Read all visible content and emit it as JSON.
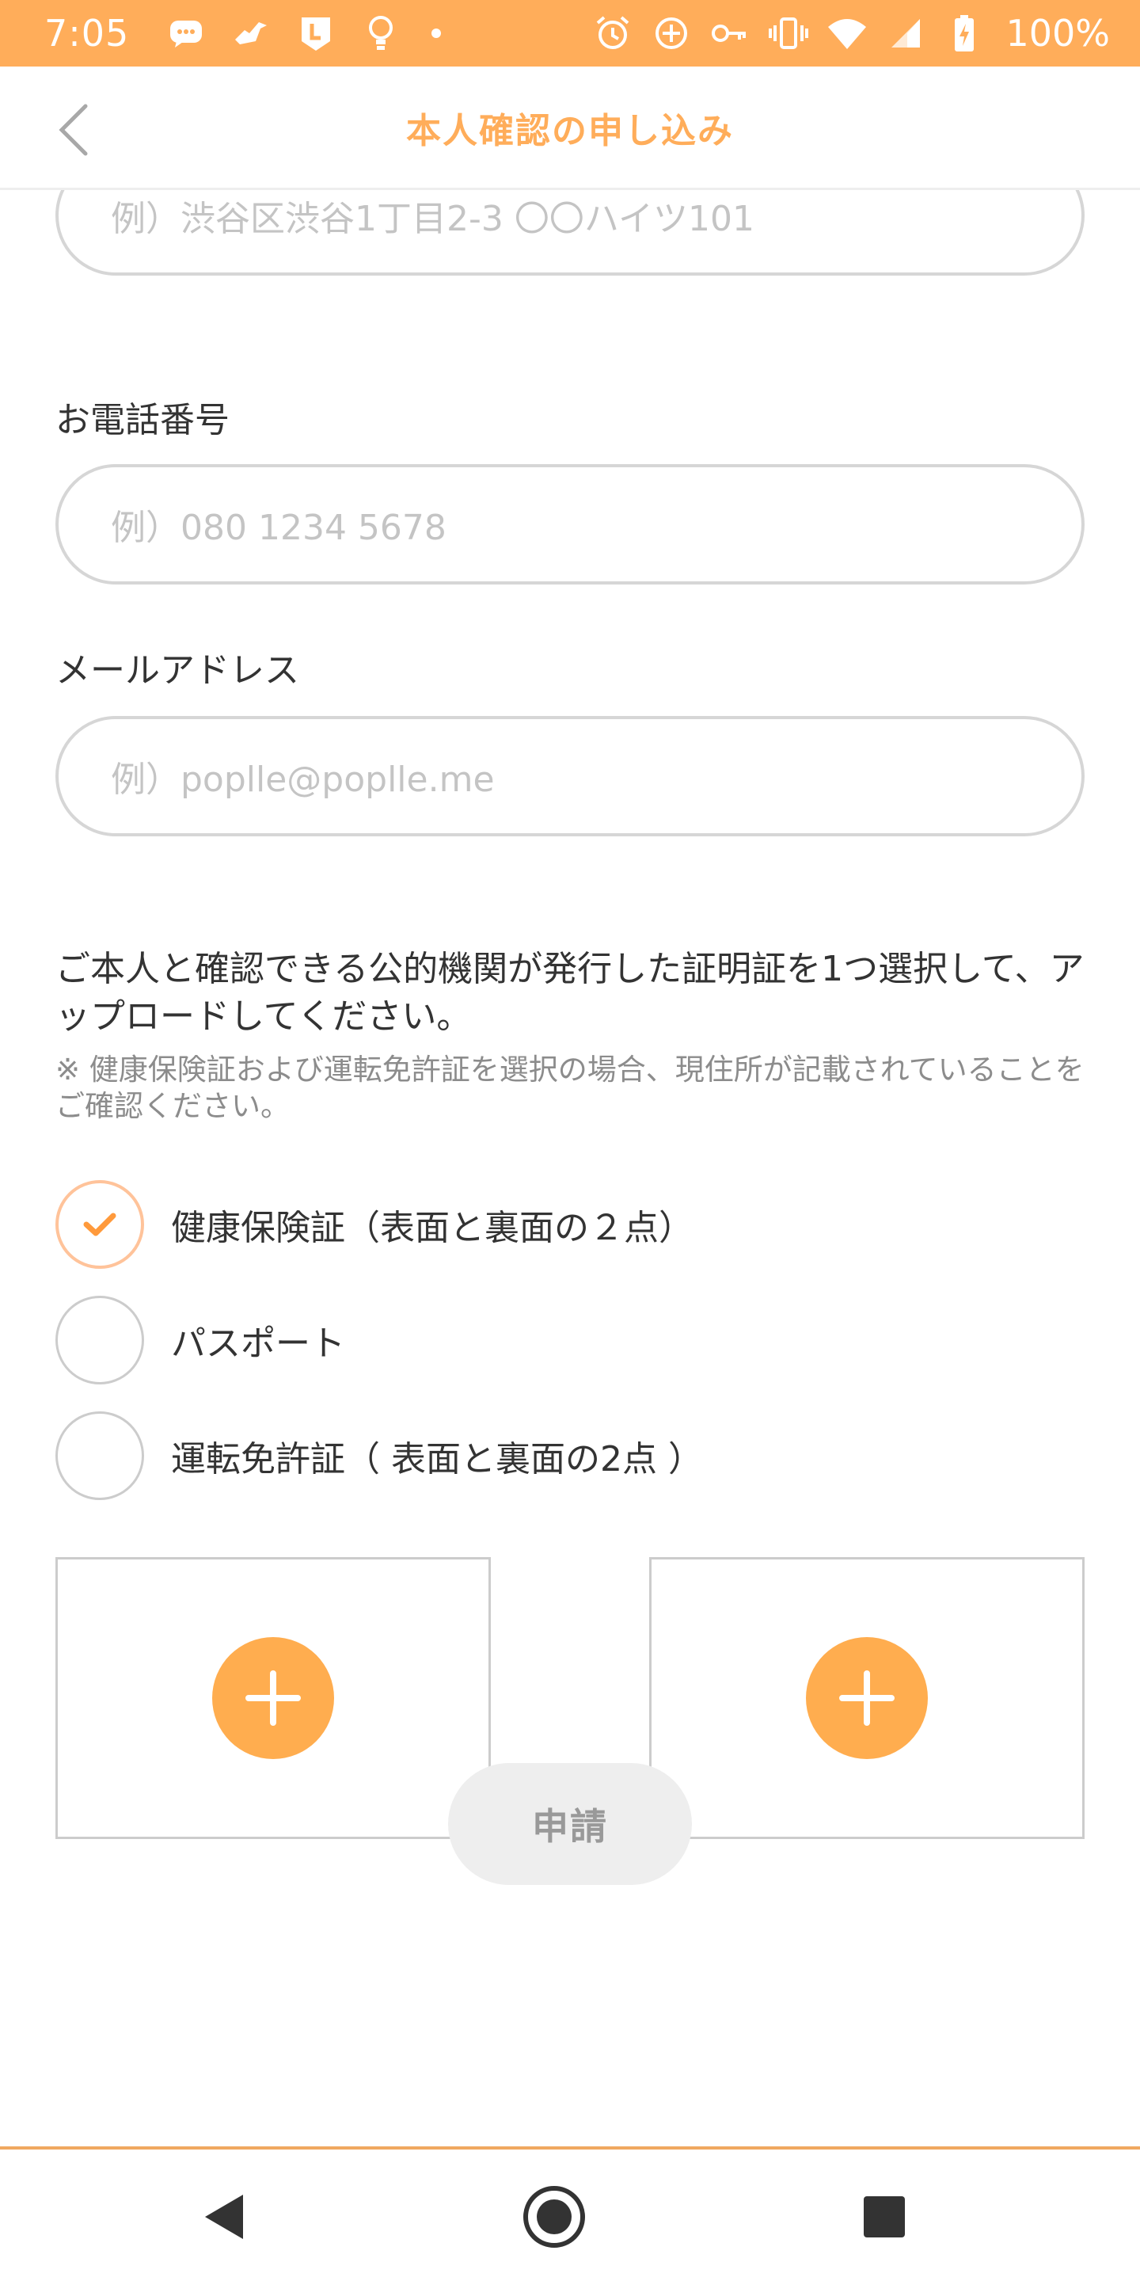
{
  "status_bar": {
    "time": "7:05",
    "battery": "100%",
    "background_color": "#ffad5a",
    "left_icons": [
      "chat-bubble-icon",
      "bird-icon",
      "line-app-icon",
      "lightbulb-icon",
      "notification-dot-icon"
    ],
    "right_icons": [
      "alarm-icon",
      "sync-icon",
      "key-icon",
      "vibrate-icon",
      "wifi-icon",
      "signal-icon",
      "battery-charging-icon"
    ]
  },
  "header": {
    "title": "本人確認の申し込み",
    "accent_color": "#ffad5a"
  },
  "form": {
    "address": {
      "placeholder": "例）渋谷区渋谷1丁目2-3 〇〇ハイツ101"
    },
    "phone": {
      "label": "お電話番号",
      "placeholder": "例）080 1234 5678"
    },
    "email": {
      "label": "メールアドレス",
      "placeholder": "例）poplle@poplle.me"
    },
    "id_instruction": "ご本人と確認できる公的機関が発行した証明証を1つ選択して、アップロードしてください。",
    "id_note": "※ 健康保険証および運転免許証を選択の場合、現住所が記載されていることをご確認ください。",
    "id_options": [
      {
        "label": "健康保険証（表面と裏面の２点）",
        "checked": true
      },
      {
        "label": "パスポート",
        "checked": false
      },
      {
        "label": "運転免許証（ 表面と裏面の2点 ）",
        "checked": false
      }
    ],
    "upload_slots": 2,
    "submit_label": "申請"
  },
  "nav_bar": {
    "buttons": [
      "back-triangle-icon",
      "home-circle-icon",
      "recents-square-icon"
    ]
  }
}
